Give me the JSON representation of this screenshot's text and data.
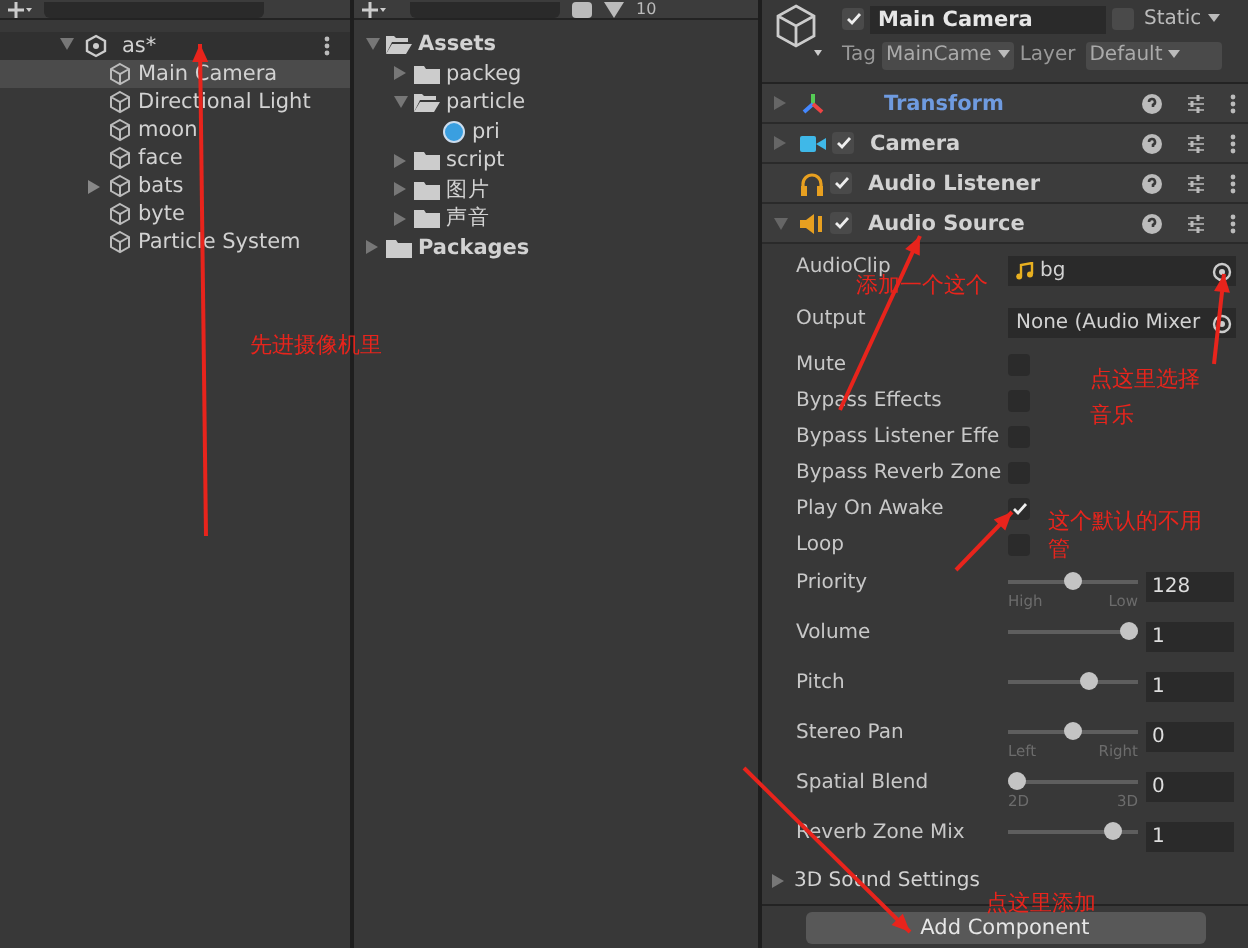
{
  "hierarchy": {
    "scene": "as*",
    "items": [
      {
        "name": "Main Camera",
        "selected": true,
        "has_children": false
      },
      {
        "name": "Directional Light",
        "selected": false,
        "has_children": false
      },
      {
        "name": "moon",
        "selected": false,
        "has_children": false
      },
      {
        "name": "face",
        "selected": false,
        "has_children": false
      },
      {
        "name": "bats",
        "selected": false,
        "has_children": true
      },
      {
        "name": "byte",
        "selected": false,
        "has_children": false
      },
      {
        "name": "Particle System",
        "selected": false,
        "has_children": false
      }
    ]
  },
  "project": {
    "count": "10",
    "tree": [
      {
        "name": "Assets",
        "kind": "folder",
        "expanded": true,
        "children": [
          {
            "name": "packeg",
            "kind": "folder",
            "expanded": false
          },
          {
            "name": "particle",
            "kind": "folder",
            "expanded": true,
            "children": [
              {
                "name": "pri",
                "kind": "particle"
              }
            ]
          },
          {
            "name": "script",
            "kind": "folder",
            "expanded": false
          },
          {
            "name": "图片",
            "kind": "folder",
            "expanded": false
          },
          {
            "name": "声音",
            "kind": "folder",
            "expanded": false
          }
        ]
      },
      {
        "name": "Packages",
        "kind": "folder",
        "expanded": false
      }
    ]
  },
  "inspector": {
    "object_name": "Main Camera",
    "active": true,
    "static_label": "Static",
    "static": false,
    "tag_label": "Tag",
    "tag": "MainCame",
    "layer_label": "Layer",
    "layer": "Default",
    "components": [
      {
        "name": "Transform",
        "kind": "transform",
        "expanded": false,
        "highlighted": true
      },
      {
        "name": "Camera",
        "kind": "camera",
        "enabled": true,
        "expanded": false,
        "highlighted": false
      },
      {
        "name": "Audio Listener",
        "kind": "listener",
        "enabled": true,
        "highlighted": false
      },
      {
        "name": "Audio Source",
        "kind": "audio",
        "enabled": true,
        "expanded": true,
        "highlighted": false
      }
    ],
    "properties": [
      {
        "label": "AudioClip",
        "kind": "object",
        "value": "bg",
        "asset": true
      },
      {
        "label": "Output",
        "kind": "object",
        "value": "None (Audio Mixer",
        "asset": false
      },
      {
        "label": "Mute",
        "kind": "toggle",
        "checked": false
      },
      {
        "label": "Bypass Effects",
        "kind": "toggle",
        "checked": false
      },
      {
        "label": "Bypass Listener Effe",
        "kind": "toggle",
        "checked": false
      },
      {
        "label": "Bypass Reverb Zone",
        "kind": "toggle",
        "checked": false
      },
      {
        "label": "Play On Awake",
        "kind": "toggle",
        "checked": true
      },
      {
        "label": "Loop",
        "kind": "toggle",
        "checked": false
      },
      {
        "label": "Priority",
        "kind": "slider",
        "level": 0.5,
        "value": "128",
        "min_label": "High",
        "max_label": "Low"
      },
      {
        "label": "Volume",
        "kind": "slider",
        "level": 1,
        "value": "1"
      },
      {
        "label": "Pitch",
        "kind": "slider",
        "level": 0.64,
        "value": "1"
      },
      {
        "label": "Stereo Pan",
        "kind": "slider",
        "level": 0.5,
        "value": "0",
        "min_label": "Left",
        "max_label": "Right"
      },
      {
        "label": "Spatial Blend",
        "kind": "slider",
        "level": 0,
        "value": "0",
        "min_label": "2D",
        "max_label": "3D"
      },
      {
        "label": "Reverb Zone Mix",
        "kind": "slider",
        "level": 0.86,
        "value": "1"
      }
    ],
    "foldout": "3D Sound Settings",
    "add_button": "Add Component"
  },
  "annotations": [
    {
      "text": "先进摄像机里"
    },
    {
      "text": "添加一个这个"
    },
    {
      "text": "点这里选择音乐"
    },
    {
      "text": "这个默认的不用管"
    },
    {
      "text": "点这里添加"
    }
  ]
}
